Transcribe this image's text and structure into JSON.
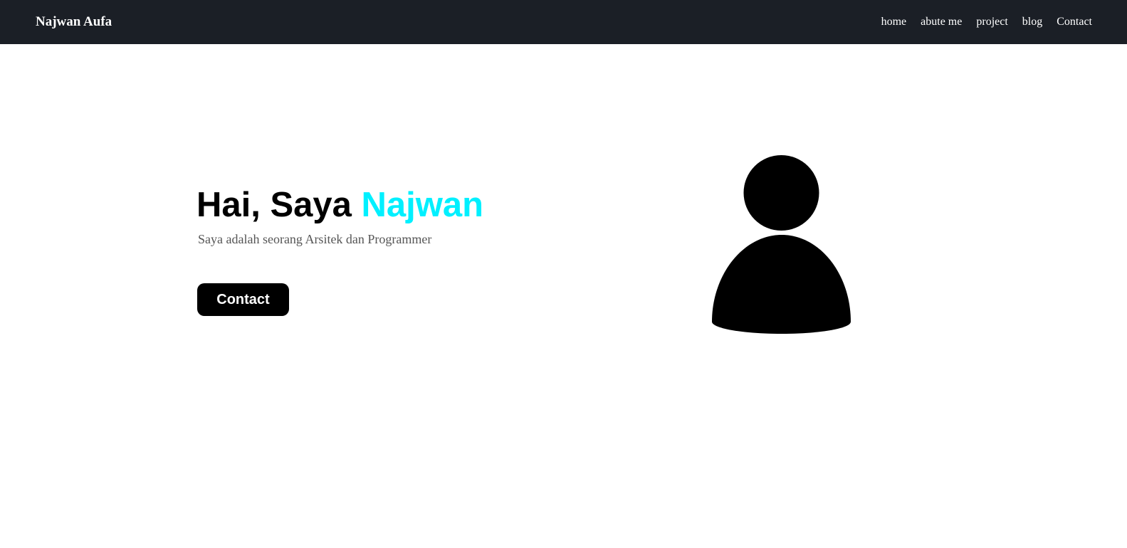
{
  "header": {
    "brand": "Najwan Aufa",
    "nav": [
      {
        "label": "home"
      },
      {
        "label": "abute me"
      },
      {
        "label": "project"
      },
      {
        "label": "blog"
      },
      {
        "label": "Contact"
      }
    ]
  },
  "hero": {
    "greeting": "Hai, Saya ",
    "name": "Najwan",
    "subtitle": "Saya adalah seorang Arsitek dan Programmer",
    "button_label": "Contact",
    "avatar_icon": "user-silhouette-icon"
  },
  "colors": {
    "navbar_bg": "#1b1f26",
    "accent": "#00f0ff",
    "button_bg": "#000000"
  }
}
